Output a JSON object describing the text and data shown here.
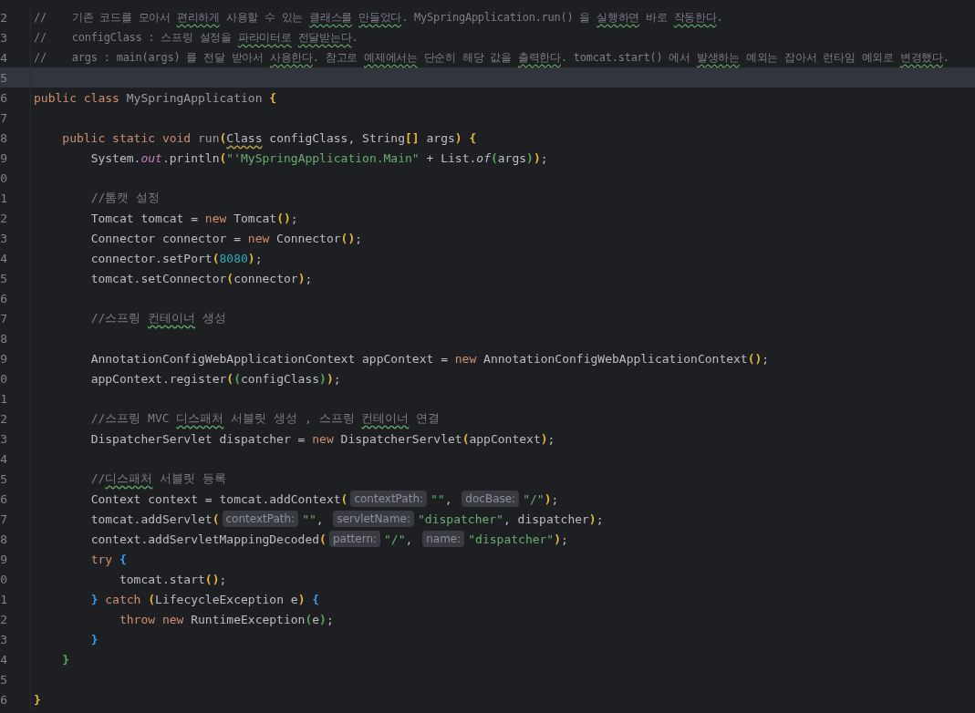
{
  "editor": {
    "lines": [
      {
        "number": "2",
        "current": false,
        "tokens": [
          {
            "kind": "comment",
            "text": "//    기존 코드를 모아서 "
          },
          {
            "kind": "typo",
            "text": "편리하게"
          },
          {
            "kind": "comment",
            "text": " 사용할 수 있는 "
          },
          {
            "kind": "typo",
            "text": "클래스를 "
          },
          {
            "kind": "typo",
            "text": "만들었다"
          },
          {
            "kind": "comment",
            "text": ". MySpringApplication.run() 을 "
          },
          {
            "kind": "typo",
            "text": "실행하면"
          },
          {
            "kind": "comment",
            "text": " 바로 "
          },
          {
            "kind": "typo",
            "text": "작동한다"
          },
          {
            "kind": "comment",
            "text": "."
          }
        ]
      },
      {
        "number": "3",
        "current": false,
        "tokens": [
          {
            "kind": "comment",
            "text": "//    configClass : 스프링 설정을 "
          },
          {
            "kind": "typo",
            "text": "파라미터로 "
          },
          {
            "kind": "typo",
            "text": "전달받는다"
          },
          {
            "kind": "comment",
            "text": "."
          }
        ]
      },
      {
        "number": "4",
        "current": false,
        "tokens": [
          {
            "kind": "comment",
            "text": "//    args : main(args) 를 전달 받아서 "
          },
          {
            "kind": "typo",
            "text": "사용한다"
          },
          {
            "kind": "comment",
            "text": ". 참고로 "
          },
          {
            "kind": "typo",
            "text": "예제에서는"
          },
          {
            "kind": "comment",
            "text": " 단순히 해당 값을 "
          },
          {
            "kind": "typo",
            "text": "출력한다"
          },
          {
            "kind": "comment",
            "text": ". tomcat.start() 에서 "
          },
          {
            "kind": "typo",
            "text": "발생하는"
          },
          {
            "kind": "comment",
            "text": " 예외는 잡아서 런타임 예외로 "
          },
          {
            "kind": "typo",
            "text": "변경했다"
          },
          {
            "kind": "comment",
            "text": "."
          }
        ]
      },
      {
        "number": "5",
        "current": true
      },
      {
        "number": "6",
        "current": false,
        "tokens": [
          {
            "kind": "keyword",
            "text": "public class "
          },
          {
            "kind": "dim",
            "text": "MySpringApplication "
          },
          {
            "kind": "bracket",
            "text": "{",
            "color": "#e8ba36"
          }
        ]
      },
      {
        "number": "7",
        "current": false
      },
      {
        "number": "8",
        "current": false,
        "tokens": [
          {
            "kind": "keyword",
            "text": "    public static void "
          },
          {
            "kind": "dim",
            "text": "run"
          },
          {
            "kind": "bracket",
            "text": "(",
            "color": "#e8ba36"
          },
          {
            "kind": "warning",
            "text": "Class"
          },
          {
            "kind": "plain",
            "text": " configClass, String"
          },
          {
            "kind": "bracket",
            "text": "[]",
            "color": "#e8ba36"
          },
          {
            "kind": "plain",
            "text": " args"
          },
          {
            "kind": "bracket",
            "text": ")",
            "color": "#e8ba36"
          },
          {
            "kind": "bracket",
            "text": " {",
            "color": "#e8ba36"
          }
        ]
      },
      {
        "number": "9",
        "current": false,
        "tokens": [
          {
            "kind": "plain",
            "text": "        System."
          },
          {
            "kind": "field",
            "text": "out"
          },
          {
            "kind": "plain",
            "text": ".println"
          },
          {
            "kind": "bracket",
            "text": "(",
            "color": "#e8ba36"
          },
          {
            "kind": "string",
            "text": "\"'MySpringApplication.Main\""
          },
          {
            "kind": "plain",
            "text": " + List."
          },
          {
            "kind": "static",
            "text": "of"
          },
          {
            "kind": "bracket",
            "text": "(",
            "color": "#54a857"
          },
          {
            "kind": "plain",
            "text": "args"
          },
          {
            "kind": "bracket",
            "text": ")",
            "color": "#54a857"
          },
          {
            "kind": "bracket",
            "text": ")",
            "color": "#e8ba36"
          },
          {
            "kind": "plain",
            "text": ";"
          }
        ]
      },
      {
        "number": "0",
        "current": false
      },
      {
        "number": "1",
        "current": false,
        "tokens": [
          {
            "kind": "comment",
            "text": "        //톰캣 설정"
          }
        ]
      },
      {
        "number": "2",
        "current": false,
        "tokens": [
          {
            "kind": "plain",
            "text": "        Tomcat tomcat = "
          },
          {
            "kind": "keyword",
            "text": "new"
          },
          {
            "kind": "plain",
            "text": " Tomcat"
          },
          {
            "kind": "bracket",
            "text": "()",
            "color": "#e8ba36"
          },
          {
            "kind": "plain",
            "text": ";"
          }
        ]
      },
      {
        "number": "3",
        "current": false,
        "tokens": [
          {
            "kind": "plain",
            "text": "        Connector connector = "
          },
          {
            "kind": "keyword",
            "text": "new"
          },
          {
            "kind": "plain",
            "text": " Connector"
          },
          {
            "kind": "bracket",
            "text": "()",
            "color": "#e8ba36"
          },
          {
            "kind": "plain",
            "text": ";"
          }
        ]
      },
      {
        "number": "4",
        "current": false,
        "tokens": [
          {
            "kind": "plain",
            "text": "        connector.setPort"
          },
          {
            "kind": "bracket",
            "text": "(",
            "color": "#e8ba36"
          },
          {
            "kind": "number",
            "text": "8080"
          },
          {
            "kind": "bracket",
            "text": ")",
            "color": "#e8ba36"
          },
          {
            "kind": "plain",
            "text": ";"
          }
        ]
      },
      {
        "number": "5",
        "current": false,
        "tokens": [
          {
            "kind": "plain",
            "text": "        tomcat.setConnector"
          },
          {
            "kind": "bracket",
            "text": "(",
            "color": "#e8ba36"
          },
          {
            "kind": "plain",
            "text": "connector"
          },
          {
            "kind": "bracket",
            "text": ")",
            "color": "#e8ba36"
          },
          {
            "kind": "plain",
            "text": ";"
          }
        ]
      },
      {
        "number": "6",
        "current": false
      },
      {
        "number": "7",
        "current": false,
        "tokens": [
          {
            "kind": "comment",
            "text": "        //스프링 "
          },
          {
            "kind": "typo",
            "text": "컨테이너"
          },
          {
            "kind": "comment",
            "text": " 생성"
          }
        ]
      },
      {
        "number": "8",
        "current": false
      },
      {
        "number": "9",
        "current": false,
        "tokens": [
          {
            "kind": "plain",
            "text": "        AnnotationConfigWebApplicationContext appContext = "
          },
          {
            "kind": "keyword",
            "text": "new"
          },
          {
            "kind": "plain",
            "text": " AnnotationConfigWebApplicationContext"
          },
          {
            "kind": "bracket",
            "text": "()",
            "color": "#e8ba36"
          },
          {
            "kind": "plain",
            "text": ";"
          }
        ]
      },
      {
        "number": "0",
        "current": false,
        "tokens": [
          {
            "kind": "plain",
            "text": "        appContext.register"
          },
          {
            "kind": "bracket",
            "text": "(",
            "color": "#e8ba36"
          },
          {
            "kind": "bracket",
            "text": "(",
            "color": "#54a857"
          },
          {
            "kind": "plain",
            "text": "configClass"
          },
          {
            "kind": "bracket",
            "text": ")",
            "color": "#54a857"
          },
          {
            "kind": "bracket",
            "text": ")",
            "color": "#e8ba36"
          },
          {
            "kind": "plain",
            "text": ";"
          }
        ]
      },
      {
        "number": "1",
        "current": false
      },
      {
        "number": "2",
        "current": false,
        "tokens": [
          {
            "kind": "comment",
            "text": "        //스프링 MVC "
          },
          {
            "kind": "typo",
            "text": "디스패처"
          },
          {
            "kind": "comment",
            "text": " 서블릿 생성 , 스프링 "
          },
          {
            "kind": "typo",
            "text": "컨테이너"
          },
          {
            "kind": "comment",
            "text": " 연결"
          }
        ]
      },
      {
        "number": "3",
        "current": false,
        "tokens": [
          {
            "kind": "plain",
            "text": "        DispatcherServlet dispatcher = "
          },
          {
            "kind": "keyword",
            "text": "new"
          },
          {
            "kind": "plain",
            "text": " DispatcherServlet"
          },
          {
            "kind": "bracket",
            "text": "(",
            "color": "#e8ba36"
          },
          {
            "kind": "plain",
            "text": "appContext"
          },
          {
            "kind": "bracket",
            "text": ")",
            "color": "#e8ba36"
          },
          {
            "kind": "plain",
            "text": ";"
          }
        ]
      },
      {
        "number": "4",
        "current": false
      },
      {
        "number": "5",
        "current": false,
        "tokens": [
          {
            "kind": "comment",
            "text": "        //"
          },
          {
            "kind": "typo",
            "text": "디스패처"
          },
          {
            "kind": "comment",
            "text": " 서블릿 등록"
          }
        ]
      },
      {
        "number": "6",
        "current": false,
        "tokens": [
          {
            "kind": "plain",
            "text": "        Context context = tomcat.addContext"
          },
          {
            "kind": "bracket",
            "text": "(",
            "color": "#e8ba36"
          },
          {
            "kind": "hint",
            "text": "contextPath:"
          },
          {
            "kind": "string",
            "text": "\"\""
          },
          {
            "kind": "plain",
            "text": ", "
          },
          {
            "kind": "hint",
            "text": "docBase:"
          },
          {
            "kind": "string",
            "text": "\"/\""
          },
          {
            "kind": "bracket",
            "text": ")",
            "color": "#e8ba36"
          },
          {
            "kind": "plain",
            "text": ";"
          }
        ]
      },
      {
        "number": "7",
        "current": false,
        "tokens": [
          {
            "kind": "plain",
            "text": "        tomcat.addServlet"
          },
          {
            "kind": "bracket",
            "text": "(",
            "color": "#e8ba36"
          },
          {
            "kind": "hint",
            "text": "contextPath:"
          },
          {
            "kind": "string",
            "text": "\"\""
          },
          {
            "kind": "plain",
            "text": ", "
          },
          {
            "kind": "hint",
            "text": "servletName:"
          },
          {
            "kind": "string",
            "text": "\"dispatcher\""
          },
          {
            "kind": "plain",
            "text": ", dispatcher"
          },
          {
            "kind": "bracket",
            "text": ")",
            "color": "#e8ba36"
          },
          {
            "kind": "plain",
            "text": ";"
          }
        ]
      },
      {
        "number": "8",
        "current": false,
        "tokens": [
          {
            "kind": "plain",
            "text": "        context.addServletMappingDecoded"
          },
          {
            "kind": "bracket",
            "text": "(",
            "color": "#e8ba36"
          },
          {
            "kind": "hint",
            "text": "pattern:"
          },
          {
            "kind": "string",
            "text": "\"/\""
          },
          {
            "kind": "plain",
            "text": ", "
          },
          {
            "kind": "hint",
            "text": "name:"
          },
          {
            "kind": "string",
            "text": "\"dispatcher\""
          },
          {
            "kind": "bracket",
            "text": ")",
            "color": "#e8ba36"
          },
          {
            "kind": "plain",
            "text": ";"
          }
        ]
      },
      {
        "number": "9",
        "current": false,
        "tokens": [
          {
            "kind": "keyword",
            "text": "        try "
          },
          {
            "kind": "bracket",
            "text": "{",
            "color": "#359ff4"
          }
        ]
      },
      {
        "number": "0",
        "current": false,
        "tokens": [
          {
            "kind": "plain",
            "text": "            tomcat.start"
          },
          {
            "kind": "bracket",
            "text": "()",
            "color": "#e8ba36"
          },
          {
            "kind": "plain",
            "text": ";"
          }
        ]
      },
      {
        "number": "1",
        "current": false,
        "tokens": [
          {
            "kind": "bracket",
            "text": "        }",
            "color": "#359ff4"
          },
          {
            "kind": "keyword",
            "text": " catch "
          },
          {
            "kind": "bracket",
            "text": "(",
            "color": "#e8ba36"
          },
          {
            "kind": "plain",
            "text": "LifecycleException e"
          },
          {
            "kind": "bracket",
            "text": ")",
            "color": "#e8ba36"
          },
          {
            "kind": "bracket",
            "text": " {",
            "color": "#359ff4"
          }
        ]
      },
      {
        "number": "2",
        "current": false,
        "tokens": [
          {
            "kind": "keyword",
            "text": "            throw new"
          },
          {
            "kind": "plain",
            "text": " RuntimeException"
          },
          {
            "kind": "bracket",
            "text": "(",
            "color": "#54a857"
          },
          {
            "kind": "plain",
            "text": "e"
          },
          {
            "kind": "bracket",
            "text": ")",
            "color": "#54a857"
          },
          {
            "kind": "plain",
            "text": ";"
          }
        ]
      },
      {
        "number": "3",
        "current": false,
        "tokens": [
          {
            "kind": "bracket",
            "text": "        }",
            "color": "#359ff4"
          }
        ]
      },
      {
        "number": "4",
        "current": false,
        "tokens": [
          {
            "kind": "bracket",
            "text": "    }",
            "color": "#54a857"
          }
        ]
      },
      {
        "number": "5",
        "current": false
      },
      {
        "number": "6",
        "current": false,
        "tokens": [
          {
            "kind": "bracket",
            "text": "}",
            "color": "#e8ba36"
          }
        ]
      }
    ]
  }
}
